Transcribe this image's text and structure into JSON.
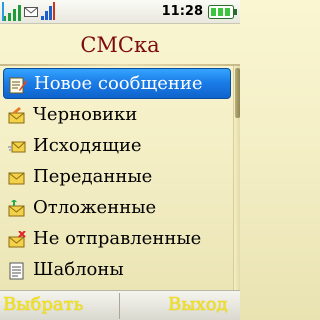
{
  "status_bar": {
    "time": "11:28",
    "icons": [
      "signal-bars-icon",
      "message-envelope-icon",
      "cell-signal-icon",
      "battery-icon"
    ]
  },
  "screen": {
    "title": "СМСка"
  },
  "menu": {
    "selected_index": 0,
    "items": [
      {
        "label": "Новое сообщение",
        "icon": "new-message-icon"
      },
      {
        "label": "Черновики",
        "icon": "drafts-icon"
      },
      {
        "label": "Исходящие",
        "icon": "outbox-icon"
      },
      {
        "label": "Переданные",
        "icon": "sent-icon"
      },
      {
        "label": "Отложенные",
        "icon": "scheduled-icon"
      },
      {
        "label": "Не отправленные",
        "icon": "unsent-icon"
      },
      {
        "label": "Шаблоны",
        "icon": "templates-icon"
      }
    ]
  },
  "softkeys": {
    "left": "Выбрать",
    "right": "Выход"
  },
  "colors": {
    "title": "#7e0c0c",
    "selection": "#1a7de8",
    "softkey": "#f3e21a",
    "background": "#f4efc6"
  }
}
